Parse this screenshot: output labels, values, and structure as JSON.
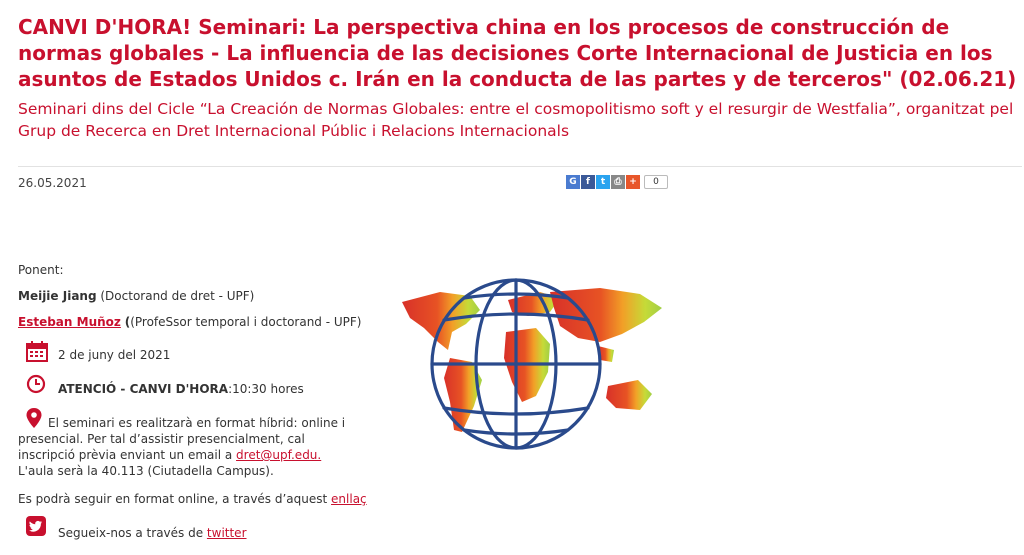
{
  "header": {
    "title": "CANVI D'HORA! Seminari: La perspectiva china en los procesos de construcción de normas globales - La influencia de las decisiones Corte Internacional de Justicia en los asuntos de Estados Unidos c. Irán en la conducta de las partes y de terceros\" (02.06.21)",
    "subtitle": "Seminari dins del Cicle “La Creación de Normas Globales: entre el cosmopolitismo soft y el resurgir de Westfalia”, organitzat pel Grup de Recerca en Dret Internacional Públic i Relacions Internacionals"
  },
  "meta": {
    "date": "26.05.2021",
    "share_count": "0",
    "share_icons": [
      "google-plus",
      "facebook",
      "twitter",
      "print",
      "more"
    ]
  },
  "content": {
    "ponent_label": "Ponent:",
    "speaker1_name": "Meijie Jiang",
    "speaker1_role": "(Doctorand de dret - UPF)",
    "speaker2_name": "Esteban Muñoz",
    "speaker2_role": "(ProfeSsor temporal i doctorand - UPF)",
    "event_date": "2 de juny del 2021",
    "time_prefix": "ATENCIÓ - CANVI D'HORA",
    "time_value": ":10:30 hores",
    "location_line1": "El seminari es realitzarà en format híbrid: online i",
    "location_line2": "presencial. Per tal d’assistir presencialment, cal",
    "location_line3_pre": "inscripció prèvia enviant un email a ",
    "location_email": "dret@upf.edu.",
    "location_line4": "L'aula serà la 40.113 (Ciutadella Campus).",
    "online_pre": "Es podrà seguir en format online, a través d’aquest ",
    "online_link": "enllaç",
    "twitter_pre": "Segueix-nos a través de ",
    "twitter_link": "twitter"
  },
  "colors": {
    "accent": "#c8102e",
    "globe_blue": "#2a4a8c"
  }
}
